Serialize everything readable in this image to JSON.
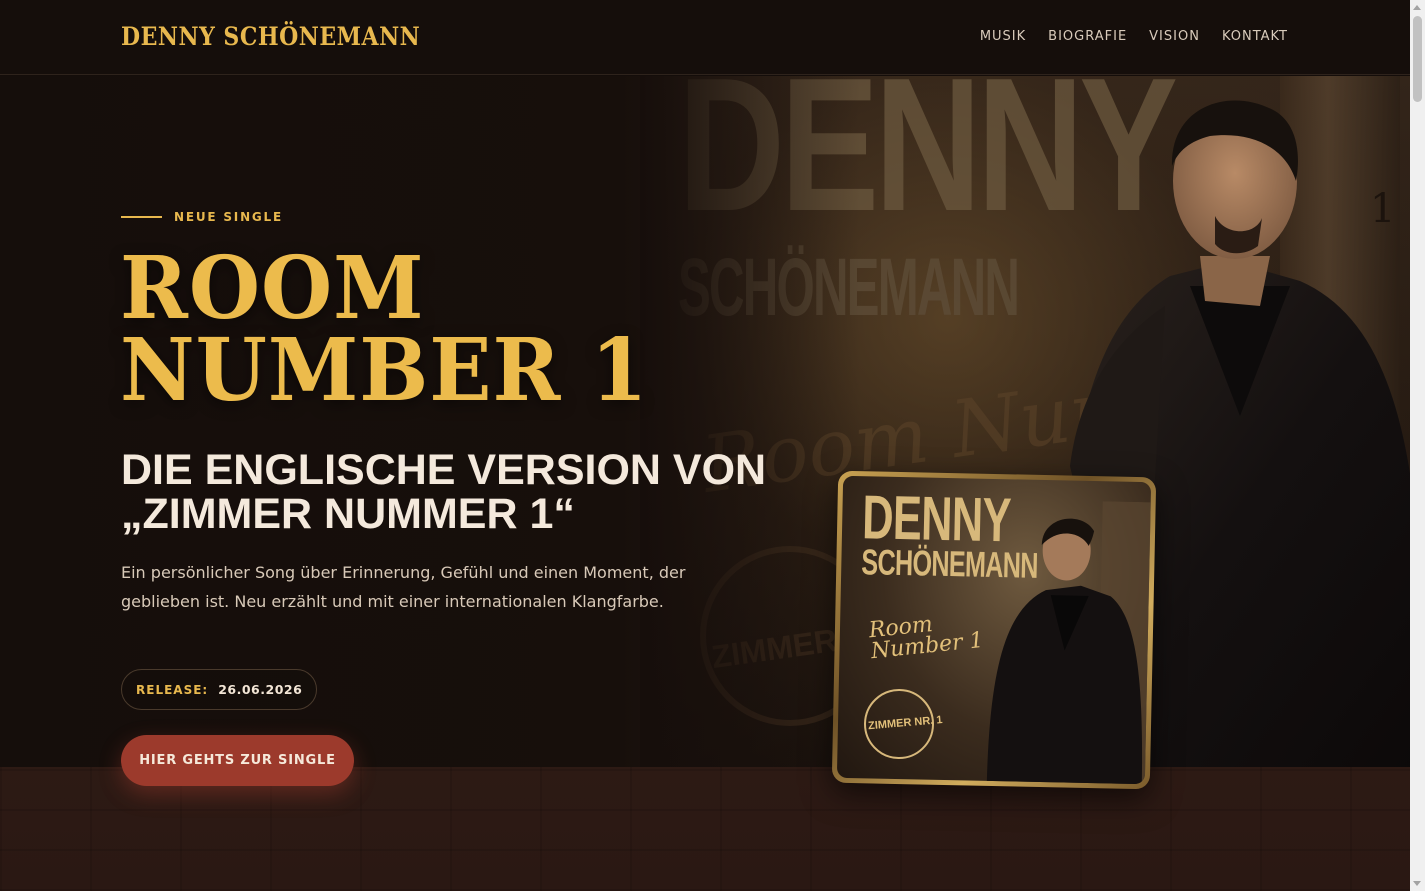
{
  "header": {
    "logo": "DENNY SCHÖNEMANN",
    "nav": [
      {
        "label": "MUSIK"
      },
      {
        "label": "BIOGRAFIE"
      },
      {
        "label": "VISION"
      },
      {
        "label": "KONTAKT"
      }
    ]
  },
  "hero": {
    "eyebrow": "NEUE SINGLE",
    "title_line1": "ROOM",
    "title_line2": "NUMBER 1",
    "subtitle_line1": "DIE ENGLISCHE VERSION VON",
    "subtitle_line2": "„ZIMMER NUMMER 1“",
    "description": "Ein persönlicher Song über Erinnerung, Gefühl und einen Moment, der geblieben ist. Neu erzählt und mit einer internationalen Klangfarbe.",
    "release_label": "RELEASE:",
    "release_date": "26.06.2026",
    "cta_label": "HIER GEHTS ZUR SINGLE"
  },
  "artwork": {
    "background_name": "DENNY",
    "background_surname": "SCHÖNEMANN",
    "background_script": "Room Number 1",
    "background_stamp": "ZIMMER NR.",
    "door_number": "1",
    "cover_name": "DENNY",
    "cover_surname": "SCHÖNEMANN",
    "cover_script_1": "Room",
    "cover_script_2": "Number 1",
    "cover_stamp": "ZIMMER NR. 1"
  },
  "colors": {
    "accent_gold": "#e8b84e",
    "cta_red": "#9c3a2c",
    "background": "#150e0b"
  }
}
